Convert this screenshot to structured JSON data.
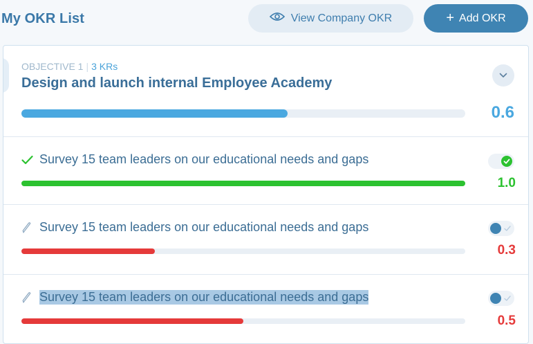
{
  "header": {
    "title": "My OKR List",
    "view_company_label": "View Company OKR",
    "add_okr_label": "Add OKR"
  },
  "objective": {
    "label": "OBJECTIVE 1",
    "kr_count": "3 KRs",
    "title": "Design and launch internal Employee Academy",
    "progress": 0.6,
    "score": "0.6",
    "color": "#4aa8e0"
  },
  "key_results": [
    {
      "text": "Survey 15 team leaders on our educational needs and gaps",
      "status_icon": "check-icon",
      "progress": 1.0,
      "score": "1.0",
      "color": "#2cc230",
      "toggle": "complete"
    },
    {
      "text": "Survey 15 team leaders on our educational needs and gaps",
      "status_icon": "pencil-icon",
      "progress": 0.3,
      "score": "0.3",
      "color": "#e53a3a",
      "toggle": "incomplete"
    },
    {
      "text": "Survey 15 team leaders on our educational needs and gaps",
      "status_icon": "pencil-icon",
      "progress": 0.5,
      "score": "0.5",
      "color": "#e53a3a",
      "toggle": "incomplete",
      "selected": true
    }
  ]
}
